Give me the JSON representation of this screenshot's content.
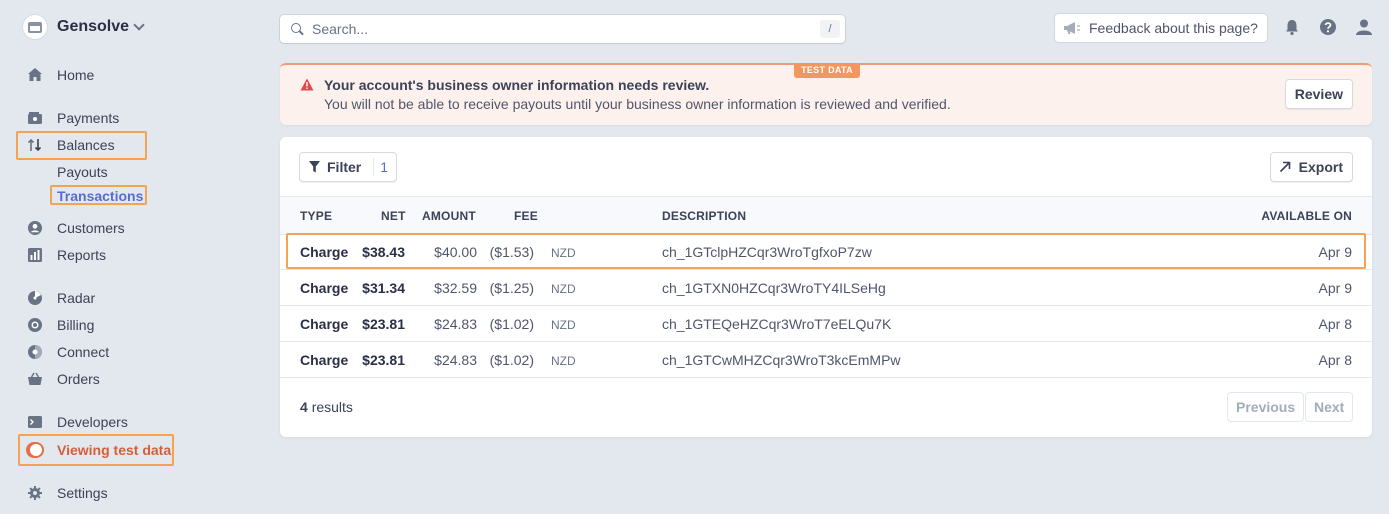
{
  "sidebar": {
    "account_name": "Gensolve",
    "nav": {
      "home": "Home",
      "payments": "Payments",
      "balances": "Balances",
      "payouts": "Payouts",
      "transactions": "Transactions",
      "customers": "Customers",
      "reports": "Reports",
      "radar": "Radar",
      "billing": "Billing",
      "connect": "Connect",
      "orders": "Orders",
      "developers": "Developers",
      "viewing_test_data": "Viewing test data",
      "settings": "Settings"
    }
  },
  "topbar": {
    "search_placeholder": "Search...",
    "search_shortcut": "/",
    "feedback_label": "Feedback about this page?"
  },
  "banner": {
    "badge": "TEST DATA",
    "title": "Your account's business owner information needs review.",
    "text": "You will not be able to receive payouts until your business owner information is reviewed and verified.",
    "review_label": "Review"
  },
  "table": {
    "filter_label": "Filter",
    "filter_count": "1",
    "export_label": "Export",
    "headers": {
      "type": "TYPE",
      "net": "NET",
      "amount": "AMOUNT",
      "fee": "FEE",
      "description": "DESCRIPTION",
      "available_on": "AVAILABLE ON"
    },
    "rows": [
      {
        "type": "Charge",
        "net": "$38.43",
        "amount": "$40.00",
        "fee": "($1.53)",
        "currency": "NZD",
        "description": "ch_1GTclpHZCqr3WroTgfxoP7zw",
        "available_on": "Apr 9"
      },
      {
        "type": "Charge",
        "net": "$31.34",
        "amount": "$32.59",
        "fee": "($1.25)",
        "currency": "NZD",
        "description": "ch_1GTXN0HZCqr3WroTY4ILSeHg",
        "available_on": "Apr 9"
      },
      {
        "type": "Charge",
        "net": "$23.81",
        "amount": "$24.83",
        "fee": "($1.02)",
        "currency": "NZD",
        "description": "ch_1GTEQeHZCqr3WroT7eELQu7K",
        "available_on": "Apr 8"
      },
      {
        "type": "Charge",
        "net": "$23.81",
        "amount": "$24.83",
        "fee": "($1.02)",
        "currency": "NZD",
        "description": "ch_1GTCwMHZCqr3WroT3kcEmMPw",
        "available_on": "Apr 8"
      }
    ],
    "results_count": "4",
    "results_label": "results",
    "previous_label": "Previous",
    "next_label": "Next"
  },
  "colors": {
    "accent": "#556cd6",
    "highlight": "#f5a352",
    "test_toggle": "#e56f4a",
    "warning": "#e0484b"
  }
}
